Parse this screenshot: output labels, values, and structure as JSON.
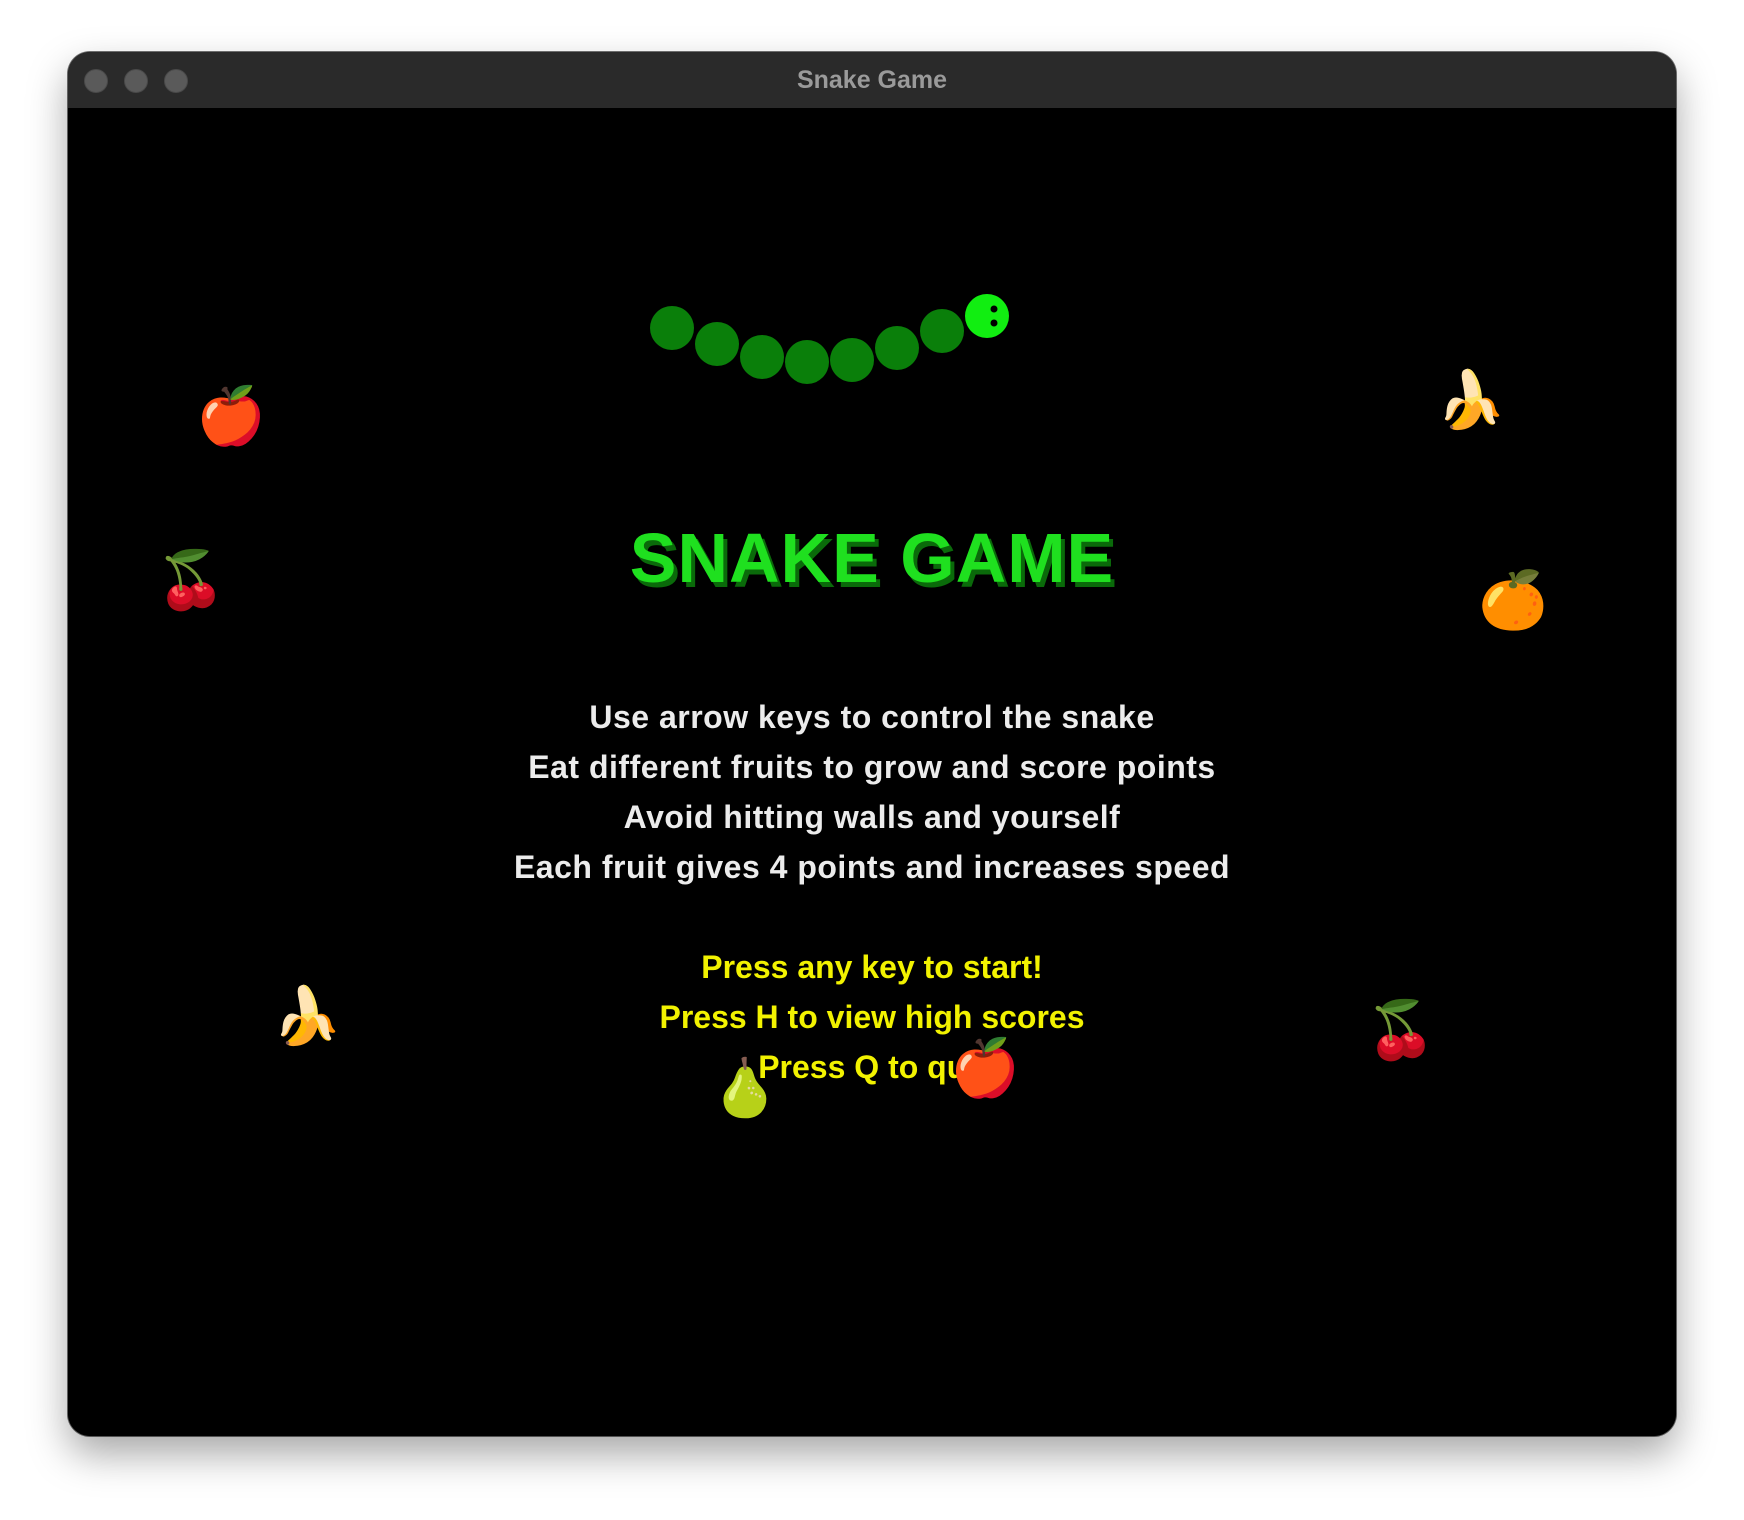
{
  "window": {
    "title": "Snake Game"
  },
  "colors": {
    "background": "#000000",
    "title_green": "#1fe01f",
    "title_shadow": "#0a6a0a",
    "snake_body": "#0a7f0a",
    "snake_head": "#11ee11",
    "instruction_text": "#ececec",
    "prompt_text": "#f2f200"
  },
  "game": {
    "title": "SNAKE GAME",
    "instructions": [
      "Use arrow keys to control the snake",
      "Eat different fruits to grow and score points",
      "Avoid hitting walls and yourself",
      "Each fruit gives 4 points and increases speed"
    ],
    "prompts": [
      "Press any key to start!",
      "Press H to view high scores",
      "Press Q to quit"
    ]
  },
  "fruits": [
    {
      "name": "apple",
      "glyph": "🍎"
    },
    {
      "name": "cherry",
      "glyph": "🍒"
    },
    {
      "name": "banana",
      "glyph": "🍌"
    },
    {
      "name": "banana",
      "glyph": "🍌"
    },
    {
      "name": "orange",
      "glyph": "🍊"
    },
    {
      "name": "pear",
      "glyph": "🍐"
    },
    {
      "name": "apple",
      "glyph": "🍎"
    },
    {
      "name": "cherry",
      "glyph": "🍒"
    }
  ],
  "snake": {
    "segment_count": 8,
    "head_direction": "right"
  }
}
